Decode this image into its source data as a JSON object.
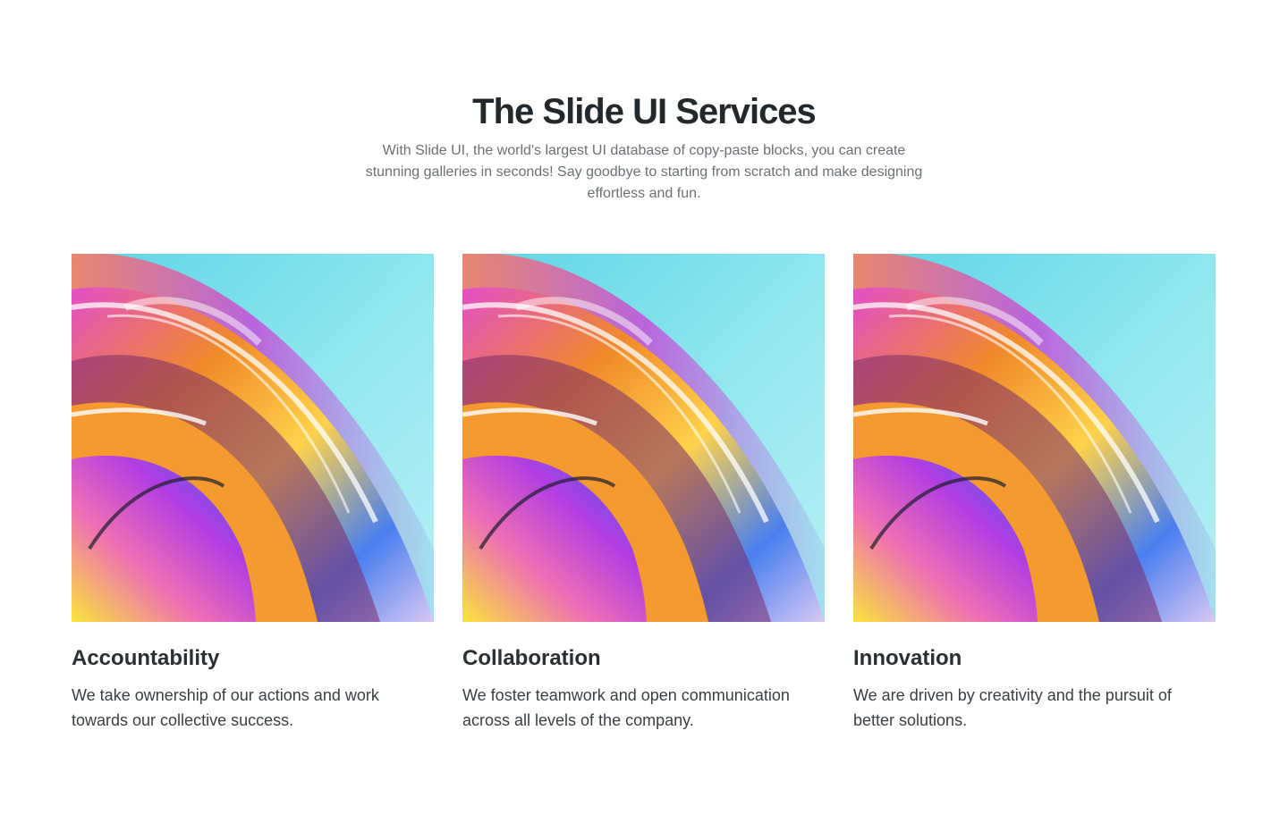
{
  "header": {
    "title": "The Slide UI Services",
    "subtitle": "With Slide UI, the world's largest UI database of copy-paste blocks, you can create stunning galleries in seconds! Say goodbye to starting from scratch and make designing effortless and fun."
  },
  "cards": [
    {
      "title": "Accountability",
      "text": "We take ownership of our actions and work towards our collective success."
    },
    {
      "title": "Collaboration",
      "text": "We foster teamwork and open communication across all levels of the company."
    },
    {
      "title": "Innovation",
      "text": "We are driven by creativity and the pursuit of better solutions."
    }
  ],
  "colors": {
    "title": "#23282c",
    "subtitle": "#6b7177",
    "body_text": "#3a3f44",
    "art_cyan": "#8fe6ee",
    "art_magenta": "#e24fc8",
    "art_orange": "#f08a2a",
    "art_blue": "#2f6bf0",
    "art_yellow": "#f7e63a"
  }
}
